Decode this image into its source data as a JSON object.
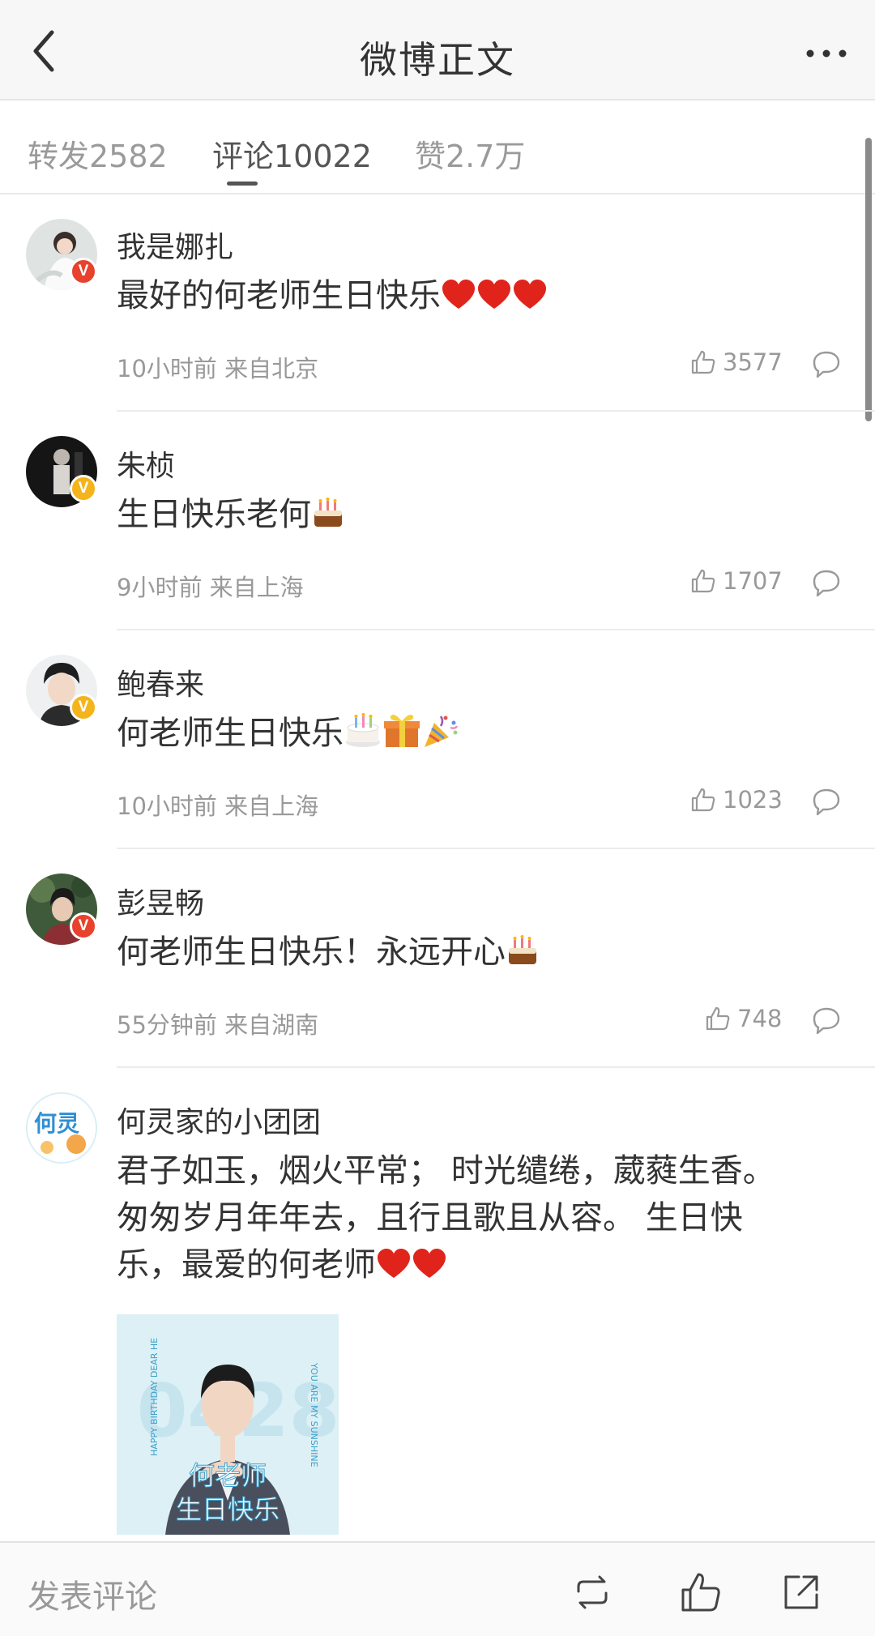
{
  "header": {
    "title": "微博正文"
  },
  "tabs": [
    {
      "label": "转发2582",
      "active": false
    },
    {
      "label": "评论10022",
      "active": true
    },
    {
      "label": "赞2.7万",
      "active": false
    }
  ],
  "comments": [
    {
      "username": "我是娜扎",
      "text": "最好的何老师生日快乐",
      "emoji": [
        "heart",
        "heart",
        "heart"
      ],
      "meta": "10小时前 来自北京",
      "likes": "3577",
      "badge": "red"
    },
    {
      "username": "朱桢",
      "text": "生日快乐老何",
      "emoji": [
        "cake"
      ],
      "meta": "9小时前 来自上海",
      "likes": "1707",
      "badge": "gold"
    },
    {
      "username": "鲍春来",
      "text": "何老师生日快乐",
      "emoji": [
        "cake",
        "gift",
        "party-popper"
      ],
      "meta": "10小时前 来自上海",
      "likes": "1023",
      "badge": "gold"
    },
    {
      "username": "彭昱畅",
      "text": "何老师生日快乐！永远开心",
      "emoji": [
        "cake"
      ],
      "meta": "55分钟前 来自湖南",
      "likes": "748",
      "badge": "red"
    },
    {
      "username": "何灵家的小团团",
      "text_lines": [
        "君子如玉，烟火平常； 时光缱绻，葳蕤生香。",
        "匆匆岁月年年去，且行且歌且从容。 生日快",
        "乐，最爱的何老师"
      ],
      "emoji": [
        "heart",
        "heart"
      ],
      "avatar_text": "何灵",
      "image": {
        "caption_line1": "何老师",
        "caption_line2": "生日快乐",
        "side_left": "HAPPY BIRTHDAY DEAR HE",
        "side_right": "YOU ARE MY SUNSHINE",
        "big_number": "0428"
      }
    }
  ],
  "bottom_bar": {
    "compose_placeholder": "发表评论",
    "icons": [
      "repost-icon",
      "like-icon",
      "share-icon"
    ]
  },
  "colors": {
    "badge_red": "#e8412c",
    "badge_gold": "#f4b41a",
    "text_primary": "#333333",
    "text_secondary": "#999999"
  }
}
